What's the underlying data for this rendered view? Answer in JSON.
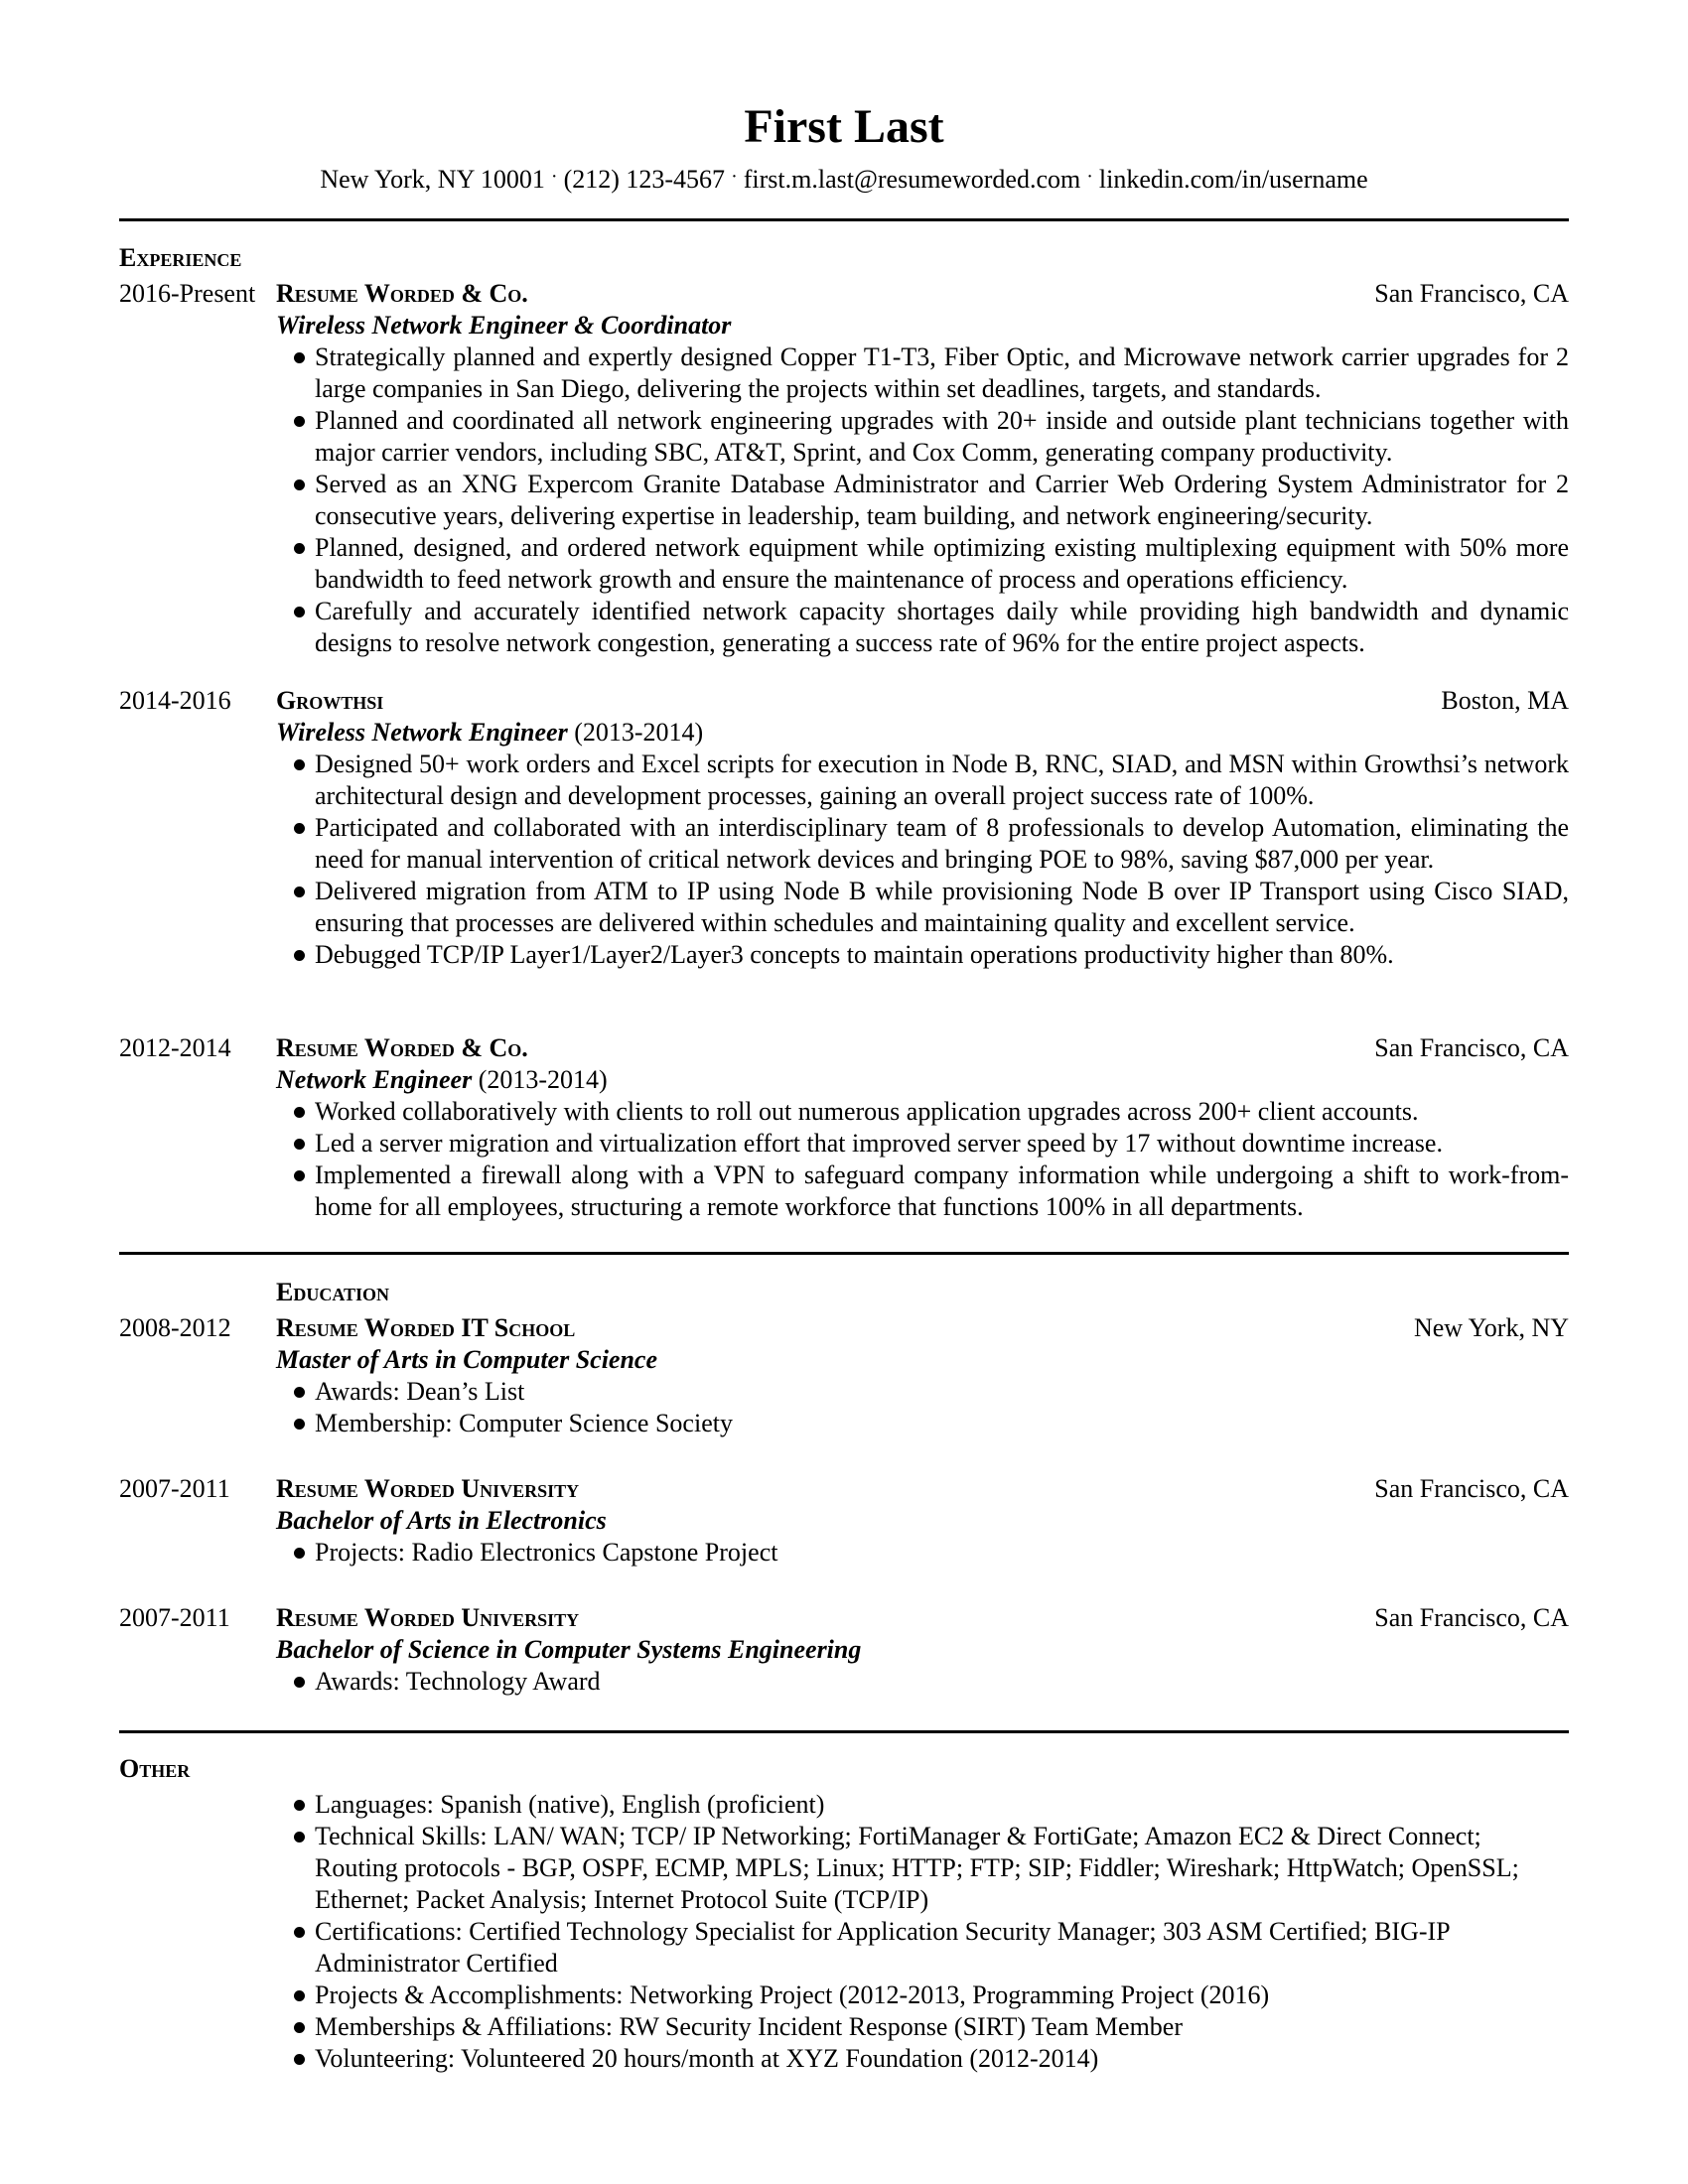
{
  "header": {
    "name": "First Last",
    "contact": [
      "New York, NY 10001",
      "(212) 123-4567",
      "first.m.last@resumeworded.com",
      "linkedin.com/in/username"
    ],
    "separator": "·"
  },
  "experience": {
    "title": "Experience",
    "entries": [
      {
        "dates": "2016-Present",
        "org": "Resume Worded & Co.",
        "location": "San Francisco, CA",
        "role": "Wireless Network Engineer & Coordinator",
        "role_dates": "",
        "bullets": [
          "Strategically planned and expertly designed Copper T1-T3, Fiber Optic, and Microwave network carrier upgrades for 2 large companies in San Diego, delivering the projects within set deadlines, targets, and standards.",
          "Planned and coordinated all network engineering upgrades with 20+ inside and outside plant technicians together with major carrier vendors, including SBC, AT&T, Sprint, and Cox Comm, generating company productivity.",
          "Served as an XNG Expercom Granite Database Administrator and Carrier Web Ordering System Administrator for 2 consecutive years, delivering expertise in leadership, team building, and network engineering/security.",
          "Planned, designed, and ordered network equipment while optimizing existing multiplexing equipment with 50% more bandwidth to feed network growth and ensure the maintenance of process and operations efficiency.",
          "Carefully and accurately identified network capacity shortages daily while providing high bandwidth and dynamic designs to resolve network congestion, generating a success rate of 96% for the entire project aspects."
        ]
      },
      {
        "dates": "2014-2016",
        "org": "Growthsi",
        "location": "Boston, MA",
        "role": "Wireless Network Engineer",
        "role_dates": "(2013-2014)",
        "bullets": [
          "Designed 50+ work orders and Excel scripts for execution in Node B, RNC, SIAD, and MSN within Growthsi’s network architectural design and development processes, gaining an overall project success rate of 100%.",
          "Participated and collaborated with an interdisciplinary team of 8 professionals to develop Automation, eliminating the need for manual intervention of critical network devices and bringing POE to 98%, saving $87,000 per year.",
          "Delivered migration from ATM to IP using Node B while provisioning Node B over IP Transport using Cisco SIAD, ensuring that processes are delivered within schedules and maintaining quality and excellent service.",
          "Debugged TCP/IP Layer1/Layer2/Layer3 concepts to maintain operations productivity higher than 80%."
        ]
      },
      {
        "dates": "2012-2014",
        "org": "Resume Worded & Co.",
        "location": "San Francisco, CA",
        "role": "Network Engineer",
        "role_dates": "(2013-2014)",
        "bullets": [
          "Worked collaboratively with clients to roll out numerous application upgrades across 200+ client accounts.",
          "Led a server migration and virtualization effort that improved server speed by 17 without downtime increase.",
          "Implemented a firewall along with a VPN to safeguard company information while undergoing a shift to work-from-home for all employees, structuring a remote workforce that functions 100% in all departments."
        ]
      }
    ]
  },
  "education": {
    "title": "Education",
    "entries": [
      {
        "dates": "2008-2012",
        "org": "Resume Worded IT School",
        "location": "New York, NY",
        "degree": "Master of Arts in Computer Science",
        "bullets": [
          "Awards: Dean’s List",
          "Membership: Computer Science Society"
        ]
      },
      {
        "dates": "2007-2011",
        "org": "Resume Worded University",
        "location": "San Francisco, CA",
        "degree": "Bachelor of Arts in Electronics",
        "bullets": [
          "Projects: Radio Electronics Capstone Project"
        ]
      },
      {
        "dates": "2007-2011",
        "org": "Resume Worded University",
        "location": "San Francisco, CA",
        "degree": "Bachelor of Science in Computer Systems Engineering",
        "bullets": [
          "Awards: Technology Award"
        ]
      }
    ]
  },
  "other": {
    "title": "Other",
    "bullets": [
      "Languages: Spanish (native), English (proficient)",
      "Technical Skills: LAN/ WAN; TCP/ IP Networking; FortiManager & FortiGate; Amazon EC2 & Direct Connect; Routing protocols - BGP, OSPF, ECMP, MPLS; Linux; HTTP; FTP; SIP; Fiddler; Wireshark; HttpWatch; OpenSSL; Ethernet; Packet Analysis; Internet Protocol Suite (TCP/IP)",
      "Certifications: Certified Technology Specialist for Application Security Manager; 303 ASM Certified; BIG-IP Administrator Certified",
      "Projects & Accomplishments: Networking Project (2012-2013, Programming Project (2016)",
      "Memberships & Affiliations: RW Security Incident Response (SIRT) Team Member",
      "Volunteering: Volunteered 20 hours/month at XYZ Foundation (2012-2014)"
    ]
  }
}
